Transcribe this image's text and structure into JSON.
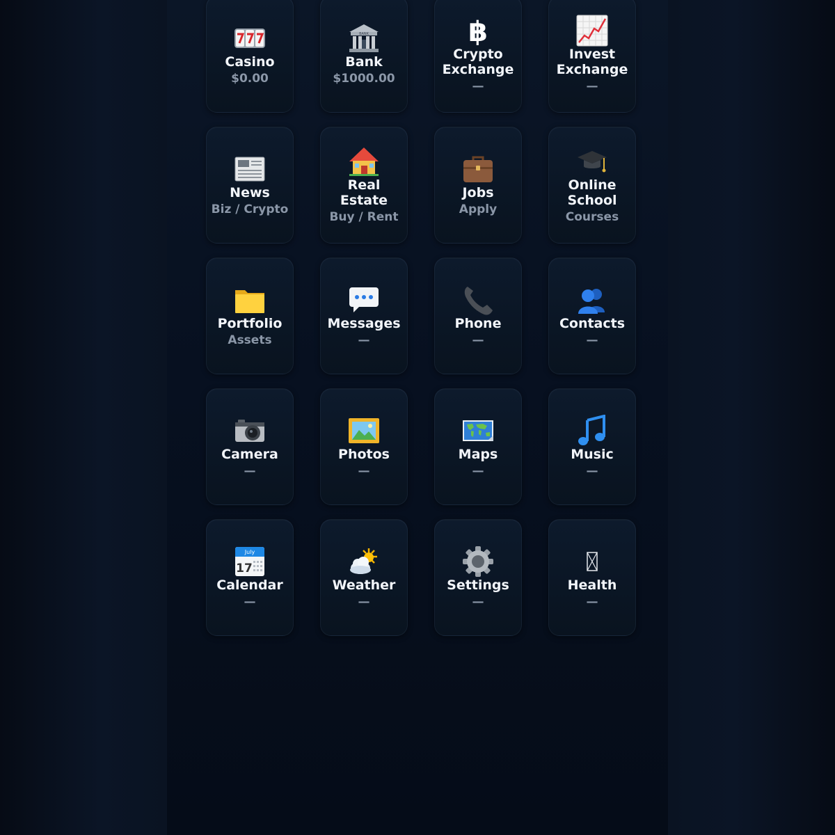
{
  "apps": [
    {
      "icon": "slot-machine-icon",
      "name": "Casino",
      "sub": "$0.00"
    },
    {
      "icon": "bank-icon",
      "name": "Bank",
      "sub": "$1000.00"
    },
    {
      "icon": "bitcoin-icon",
      "name": "Crypto Exchange",
      "sub": "—"
    },
    {
      "icon": "chart-increasing-icon",
      "name": "Invest Exchange",
      "sub": "—"
    },
    {
      "icon": "newspaper-icon",
      "name": "News",
      "sub": "Biz / Crypto"
    },
    {
      "icon": "house-icon",
      "name": "Real Estate",
      "sub": "Buy / Rent"
    },
    {
      "icon": "briefcase-icon",
      "name": "Jobs",
      "sub": "Apply"
    },
    {
      "icon": "graduation-cap-icon",
      "name": "Online School",
      "sub": "Courses"
    },
    {
      "icon": "folder-icon",
      "name": "Portfolio",
      "sub": "Assets"
    },
    {
      "icon": "speech-bubble-icon",
      "name": "Messages",
      "sub": "—"
    },
    {
      "icon": "phone-receiver-icon",
      "name": "Phone",
      "sub": "—"
    },
    {
      "icon": "people-icon",
      "name": "Contacts",
      "sub": "—"
    },
    {
      "icon": "camera-icon",
      "name": "Camera",
      "sub": "—"
    },
    {
      "icon": "framed-picture-icon",
      "name": "Photos",
      "sub": "—"
    },
    {
      "icon": "world-map-icon",
      "name": "Maps",
      "sub": "—"
    },
    {
      "icon": "music-note-icon",
      "name": "Music",
      "sub": "—"
    },
    {
      "icon": "calendar-icon",
      "name": "Calendar",
      "sub": "—",
      "icon_text": {
        "month": "July",
        "day": "17"
      }
    },
    {
      "icon": "sun-behind-cloud-icon",
      "name": "Weather",
      "sub": "—"
    },
    {
      "icon": "gear-icon",
      "name": "Settings",
      "sub": "—"
    },
    {
      "icon": "missing-glyph-icon",
      "name": "Health",
      "sub": "—"
    }
  ]
}
